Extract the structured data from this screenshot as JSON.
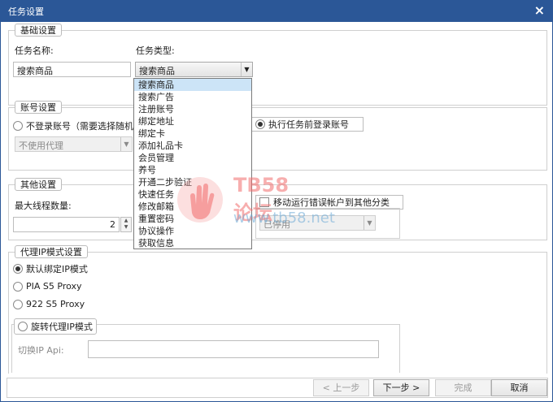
{
  "window": {
    "title": "任务设置",
    "close_glyph": "×"
  },
  "basic": {
    "legend": "基础设置",
    "task_name_label": "任务名称:",
    "task_name_value": "搜索商品",
    "task_type_label": "任务类型:",
    "task_type_value": "搜索商品"
  },
  "task_type_options": [
    "搜索商品",
    "搜索广告",
    "注册账号",
    "绑定地址",
    "绑定卡",
    "添加礼品卡",
    "会员管理",
    "养号",
    "开通二步验证",
    "快速任务",
    "修改邮箱",
    "重置密码",
    "协议操作",
    "获取信息"
  ],
  "account": {
    "legend": "账号设置",
    "no_login_label": "不登录账号（需要选择随机",
    "login_before_label": "执行任务前登录账号",
    "proxy_select_value": "不使用代理"
  },
  "other": {
    "legend": "其他设置",
    "max_threads_label": "最大线程数量:",
    "max_threads_value": "2",
    "move_error_label": "移动运行错误帐户到其他分类",
    "category_select_value": "已停用"
  },
  "proxy_mode": {
    "legend": "代理IP模式设置",
    "default_bind_label": "默认绑定IP模式",
    "pia_label": "PIA S5 Proxy",
    "s922_label": "922 S5 Proxy",
    "rotate_label": "旋转代理IP模式",
    "switch_api_label": "切换IP Api:"
  },
  "buttons": {
    "prev": "< 上一步",
    "next": "下一步 >",
    "finish": "完成",
    "cancel": "取消"
  },
  "watermark": {
    "title": "TB58论坛",
    "url": "www.tb58.net"
  }
}
